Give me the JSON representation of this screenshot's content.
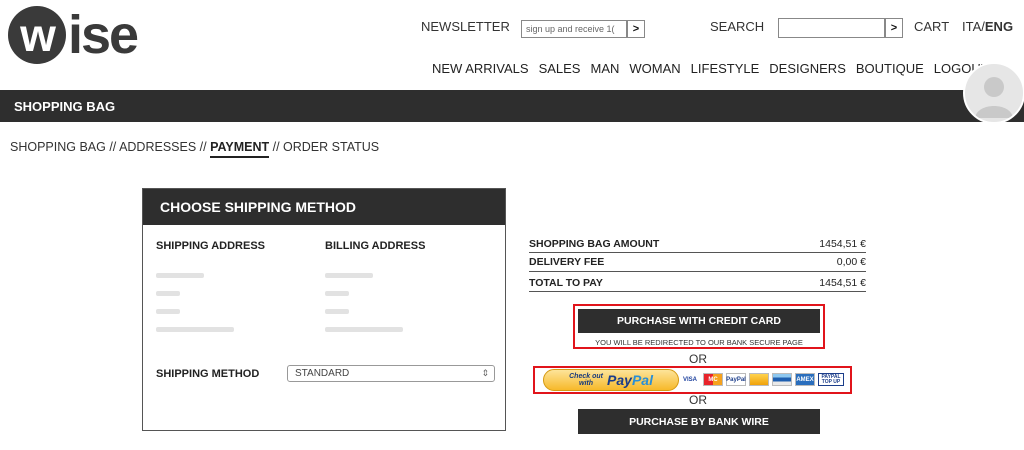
{
  "logo": {
    "w": "w",
    "rest": "ise"
  },
  "header": {
    "newsletter_label": "NEWSLETTER",
    "newsletter_placeholder": "sign up and receive 1(",
    "search_label": "SEARCH",
    "search_placeholder": "",
    "go_glyph": ">",
    "cart_label": "CART",
    "lang_ita": "ITA",
    "lang_sep": "/",
    "lang_eng": "ENG"
  },
  "nav": {
    "items": [
      "NEW ARRIVALS",
      "SALES",
      "MAN",
      "WOMAN",
      "LIFESTYLE",
      "DESIGNERS",
      "BOUTIQUE",
      "LOGOUT"
    ]
  },
  "title_bar": {
    "title": "SHOPPING BAG"
  },
  "breadcrumb": {
    "step1": "SHOPPING BAG",
    "sep": " // ",
    "step2": "ADDRESSES",
    "step3": "PAYMENT",
    "step4": "ORDER STATUS"
  },
  "shipping_panel": {
    "title": "CHOOSE SHIPPING METHOD",
    "shipping_address_label": "SHIPPING ADDRESS",
    "billing_address_label": "BILLING ADDRESS",
    "shipping_method_label": "SHIPPING METHOD",
    "shipping_method_value": "STANDARD",
    "select_arrow": "⇕"
  },
  "summary": {
    "rows": [
      {
        "label": "SHOPPING BAG AMOUNT",
        "value": "1454,51 €"
      },
      {
        "label": "DELIVERY FEE",
        "value": "0,00 €"
      },
      {
        "label": "TOTAL TO PAY",
        "value": "1454,51 €"
      }
    ]
  },
  "payment": {
    "credit_card_button": "PURCHASE WITH CREDIT CARD",
    "redirect_note": "YOU WILL BE REDIRECTED TO OUR BANK SECURE PAGE",
    "or1": "OR",
    "paypal_checkout_text": "Check out with",
    "paypal_brand_pay": "Pay",
    "paypal_brand_pal": "Pal",
    "cards": [
      "VISA",
      "MC",
      "PayPal",
      "",
      "",
      "AMEX",
      "PAYPAL TOP UP"
    ],
    "or2": "OR",
    "bank_wire_button": "PURCHASE BY BANK WIRE"
  },
  "colors": {
    "dark": "#2e2e2e",
    "highlight_red": "#e1141b",
    "paypal_gold": "#f7b92a"
  }
}
